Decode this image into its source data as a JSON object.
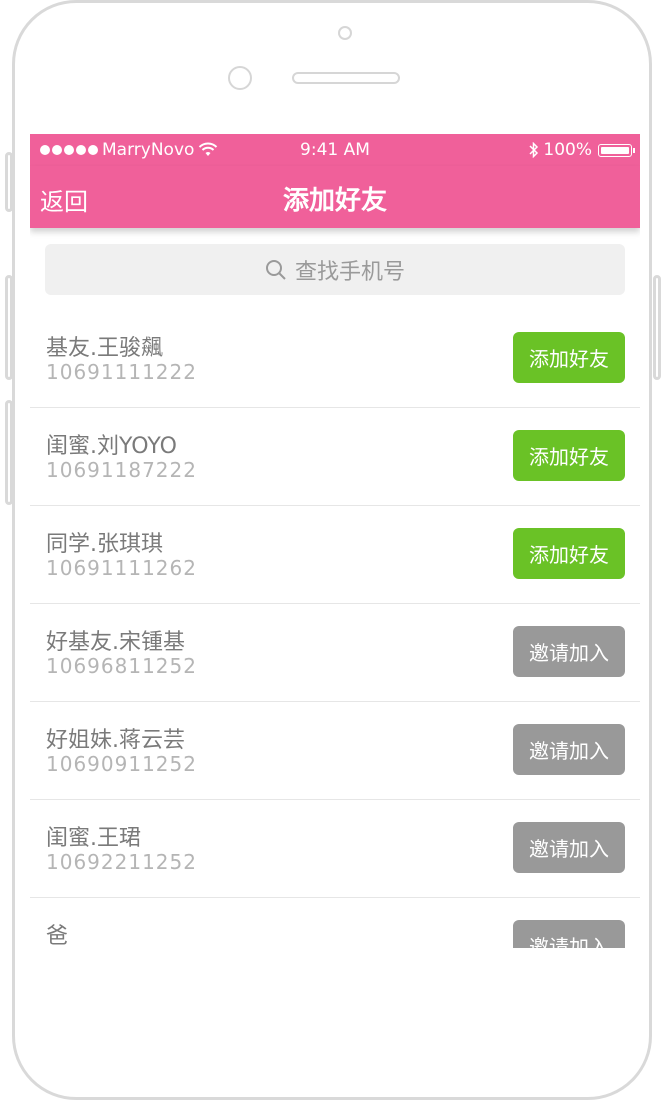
{
  "status_bar": {
    "carrier": "MarryNovo",
    "time": "9:41 AM",
    "battery": "100%"
  },
  "nav": {
    "back_label": "返回",
    "title": "添加好友"
  },
  "search": {
    "placeholder": "查找手机号"
  },
  "contacts": [
    {
      "name": "基友.王骏飆",
      "phone": "10691111222",
      "action": "添加好友",
      "action_type": "add"
    },
    {
      "name": "闺蜜.刘YOYO",
      "phone": "10691187222",
      "action": "添加好友",
      "action_type": "add"
    },
    {
      "name": "同学.张琪琪",
      "phone": "10691111262",
      "action": "添加好友",
      "action_type": "add"
    },
    {
      "name": "好基友.宋锺基",
      "phone": "10696811252",
      "action": "邀请加入",
      "action_type": "invite"
    },
    {
      "name": "好姐妹.蒋云芸",
      "phone": "10690911252",
      "action": "邀请加入",
      "action_type": "invite"
    },
    {
      "name": "闺蜜.王珺",
      "phone": "10692211252",
      "action": "邀请加入",
      "action_type": "invite"
    },
    {
      "name": "爸",
      "phone": "",
      "action": "邀请加入",
      "action_type": "invite"
    }
  ],
  "colors": {
    "nav": "#f0609a",
    "add_button": "#6ac226",
    "invite_button": "#999999"
  },
  "icons": {
    "search": "search-icon",
    "wifi": "wifi-icon",
    "bluetooth": "bluetooth-icon",
    "battery": "battery-icon"
  }
}
